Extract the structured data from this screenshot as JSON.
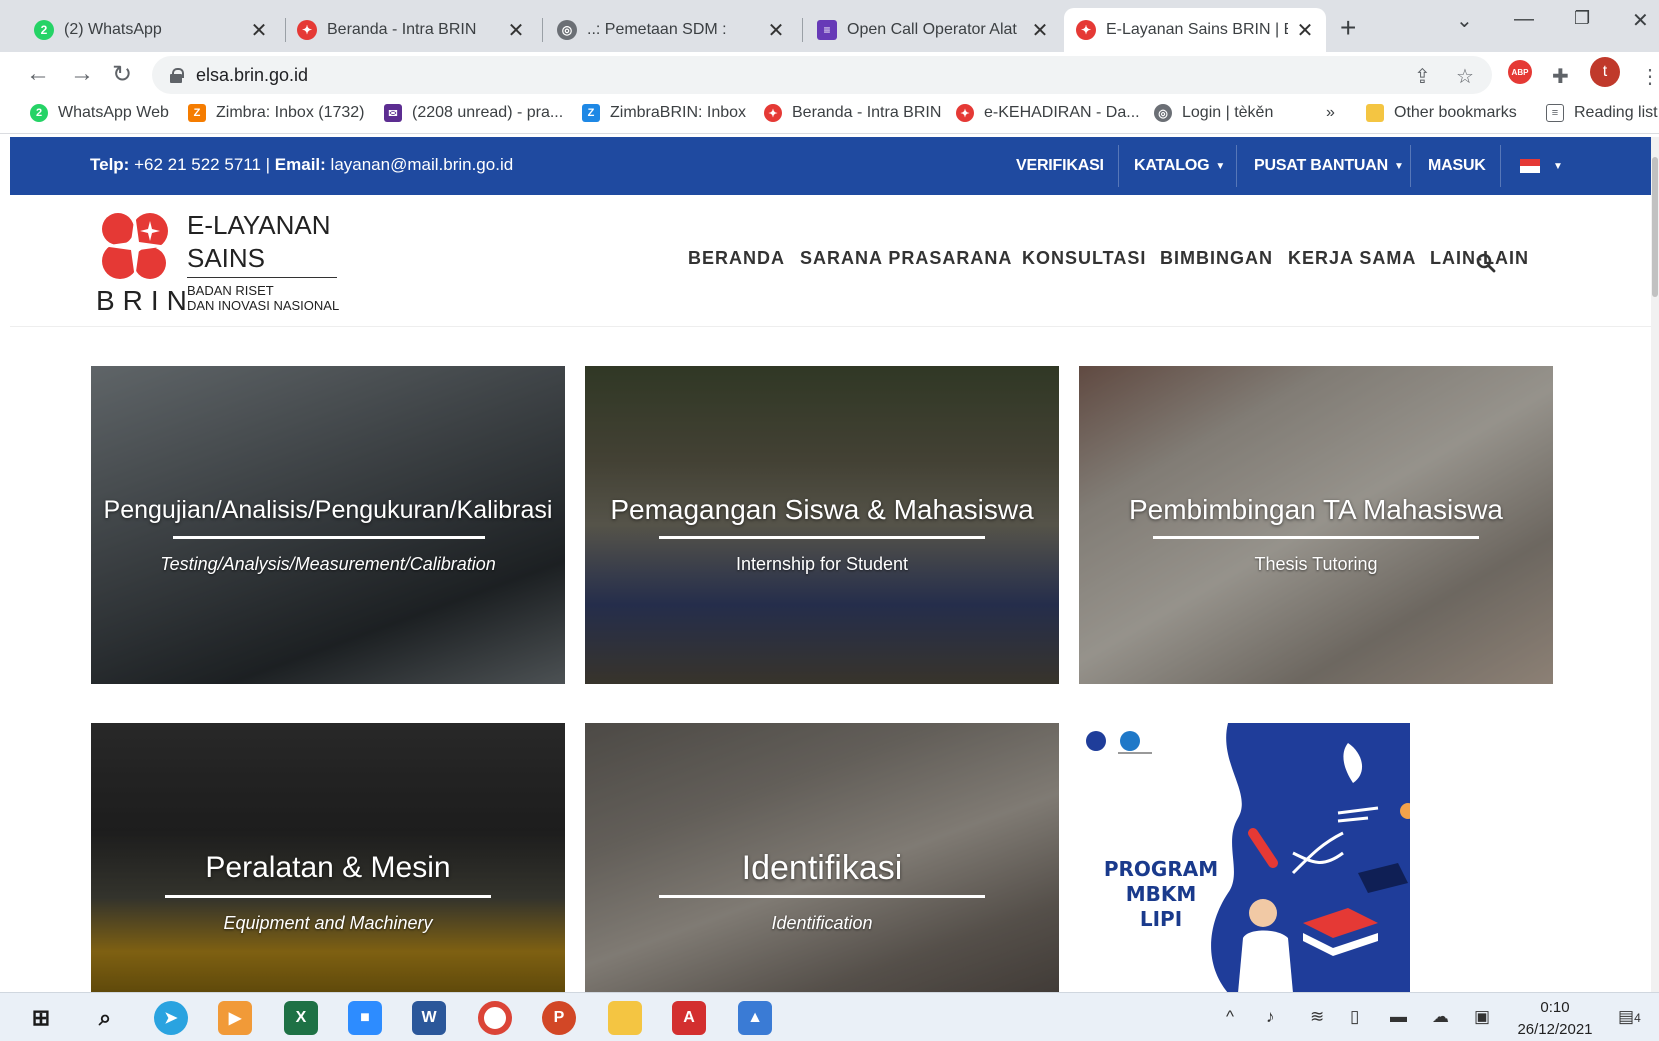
{
  "browser": {
    "tabs": [
      {
        "title": "(2) WhatsApp",
        "icon": "whatsapp-icon",
        "color": "#25d366",
        "badge": "2"
      },
      {
        "title": "Beranda - Intra BRIN",
        "icon": "brin-icon",
        "color": "#e53935"
      },
      {
        "title": "..: Pemetaan SDM :",
        "icon": "globe-icon",
        "color": "#5f6368"
      },
      {
        "title": "Open Call Operator Alat",
        "icon": "forms-icon",
        "color": "#673ab7"
      },
      {
        "title": "E-Layanan Sains BRIN | Be",
        "icon": "brin-icon",
        "color": "#e53935"
      }
    ],
    "active_tab": 4,
    "url": "elsa.brin.go.id",
    "abp_label": "ABP",
    "profile_initial": "t",
    "bookmarks": [
      {
        "label": "WhatsApp Web",
        "icon": "whatsapp-icon",
        "color": "#25d366",
        "glyph": "2"
      },
      {
        "label": "Zimbra: Inbox (1732)",
        "icon": "zimbra-icon",
        "color": "#f57c00",
        "glyph": "Z"
      },
      {
        "label": "(2208 unread) - pra...",
        "icon": "mail-icon",
        "color": "#5c2d91",
        "glyph": "✉"
      },
      {
        "label": "ZimbraBRIN: Inbox",
        "icon": "zimbra-icon",
        "color": "#1e88e5",
        "glyph": "Z"
      },
      {
        "label": "Beranda - Intra BRIN",
        "icon": "brin-icon",
        "color": "#e53935",
        "glyph": "✦"
      },
      {
        "label": "e-KEHADIRAN - Da...",
        "icon": "brin-icon",
        "color": "#e53935",
        "glyph": "✦"
      },
      {
        "label": "Login | tèkěn",
        "icon": "globe-icon",
        "color": "#5f6368",
        "glyph": "◎"
      }
    ],
    "more_bookmarks": "»",
    "other_bookmarks": "Other bookmarks",
    "reading_list": "Reading list"
  },
  "site": {
    "contact": {
      "phone_label": "Telp:",
      "phone": " +62 21 522 5711 | ",
      "email_label": "Email:",
      "email": " layanan@mail.brin.go.id"
    },
    "topnav": [
      "VERIFIKASI",
      "KATALOG",
      "PUSAT BANTUAN",
      "MASUK"
    ],
    "logo": {
      "line1": "E-LAYANAN",
      "line2": "SAINS",
      "brand": "BRIN",
      "sub1": "BADAN RISET",
      "sub2": "DAN INOVASI NASIONAL"
    },
    "mainnav": [
      "BERANDA",
      "SARANA PRASARANA",
      "KONSULTASI",
      "BIMBINGAN",
      "KERJA SAMA",
      "LAIN-LAIN"
    ],
    "cards": [
      {
        "title": "Pengujian/Analisis/Pengukuran/Kalibrasi",
        "subtitle": "Testing/Analysis/Measurement/Calibration"
      },
      {
        "title": "Pemagangan Siswa & Mahasiswa",
        "subtitle": "Internship for Student"
      },
      {
        "title": "Pembimbingan TA Mahasiswa",
        "subtitle": "Thesis Tutoring"
      },
      {
        "title": "Peralatan & Mesin",
        "subtitle": "Equipment and Machinery"
      },
      {
        "title": "Identifikasi",
        "subtitle": "Identification"
      }
    ],
    "promo": {
      "line1": "PROGRAM",
      "line2": "MBKM",
      "line3": "LIPI"
    },
    "colors": {
      "primary": "#1f4aa0",
      "brand_red": "#e53935"
    }
  },
  "taskbar": {
    "time": "0:10",
    "date": "26/12/2021",
    "notifications": "4"
  }
}
